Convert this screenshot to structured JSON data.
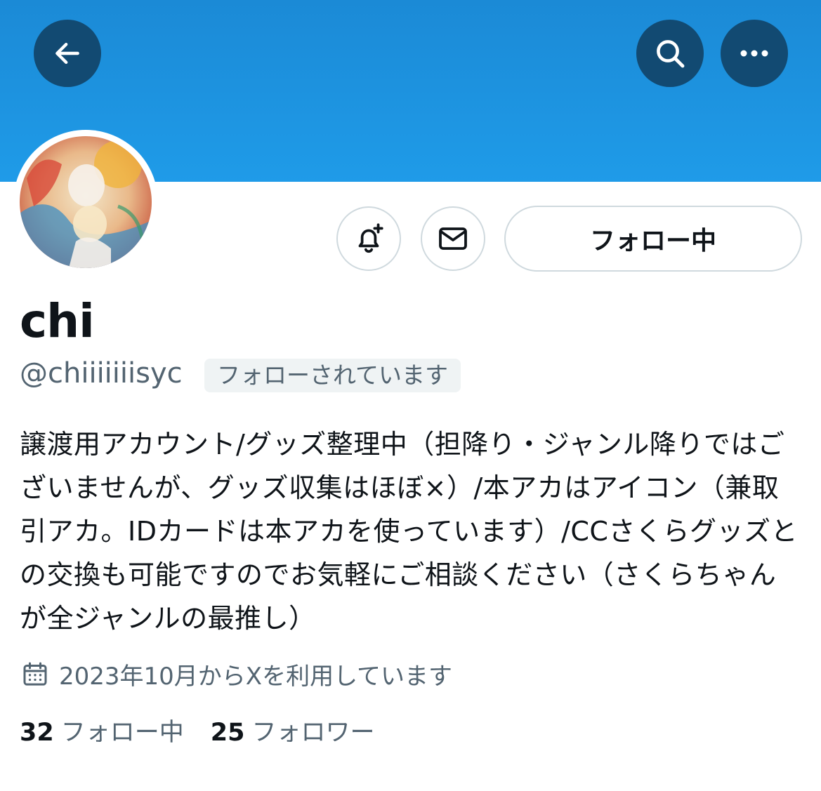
{
  "colors": {
    "banner": "#1f9be8",
    "header_button_bg": "#124a72",
    "secondary_text": "#536471",
    "primary_text": "#0f1419",
    "border": "#cfd9de"
  },
  "header": {
    "back_icon": "arrow-left-icon",
    "search_icon": "search-icon",
    "more_icon": "more-horizontal-icon"
  },
  "profile": {
    "display_name": "chi",
    "handle": "@chiiiiiiisyc",
    "follows_you": "フォローされています",
    "follow_button_label": "フォロー中",
    "notify_icon": "bell-plus-icon",
    "message_icon": "envelope-icon",
    "bio": "譲渡用アカウント/グッズ整理中（担降り・ジャンル降りではございませんが、グッズ収集はほぼ×）/本アカはアイコン（兼取引アカ。IDカードは本アカを使っています）/CCさくらグッズとの交換も可能ですのでお気軽にご相談ください（さくらちゃんが全ジャンルの最推し）",
    "joined": "2023年10月からXを利用しています",
    "calendar_icon": "calendar-icon"
  },
  "stats": {
    "following_count": "32",
    "following_label": "フォロー中",
    "followers_count": "25",
    "followers_label": "フォロワー"
  }
}
